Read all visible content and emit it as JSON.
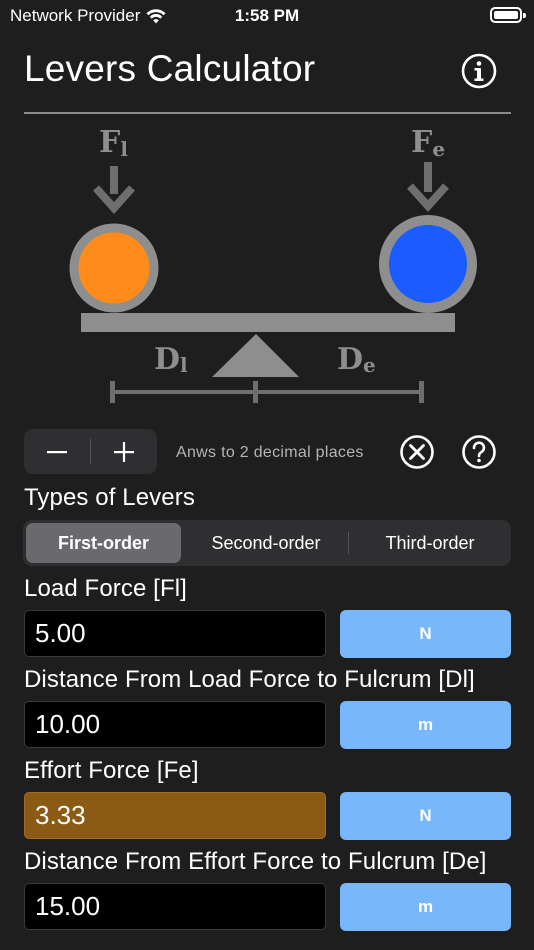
{
  "status_bar": {
    "carrier": "Network Provider",
    "time": "1:58 PM",
    "icons": [
      "wifi-icon",
      "battery-icon"
    ]
  },
  "header": {
    "title": "Levers Calculator",
    "icon": "info-icon"
  },
  "diagram": {
    "load_label": {
      "main": "F",
      "sub": "l"
    },
    "effort_label": {
      "main": "F",
      "sub": "e"
    },
    "load_distance_label": {
      "main": "D",
      "sub": "l"
    },
    "effort_distance_label": {
      "main": "D",
      "sub": "e"
    },
    "colors": {
      "load_ball": "#ff8c1a",
      "effort_ball": "#1a5cff",
      "structure": "#8e8e8e",
      "arrow": "#6e6e6e"
    }
  },
  "controls": {
    "minus_icon": "minus-icon",
    "plus_icon": "plus-icon",
    "precision_text": "Anws to 2 decimal places",
    "clear_icon": "clear-circle-icon",
    "help_icon": "question-circle-icon"
  },
  "lever_types": {
    "label": "Types of Levers",
    "options": [
      "First-order",
      "Second-order",
      "Third-order"
    ],
    "selected": "First-order"
  },
  "fields": [
    {
      "label": "Load Force [Fl]",
      "value": "5.00",
      "unit": "N",
      "is_result": false
    },
    {
      "label": "Distance From Load Force to Fulcrum [Dl]",
      "value": "10.00",
      "unit": "m",
      "is_result": false
    },
    {
      "label": "Effort Force [Fe]",
      "value": "3.33",
      "unit": "N",
      "is_result": true
    },
    {
      "label": "Distance From Effort Force to Fulcrum [De]",
      "value": "15.00",
      "unit": "m",
      "is_result": false
    }
  ],
  "colors": {
    "background": "#1e1e1e",
    "unit_button": "#79b7fb",
    "result_field": "#8b5a14"
  }
}
